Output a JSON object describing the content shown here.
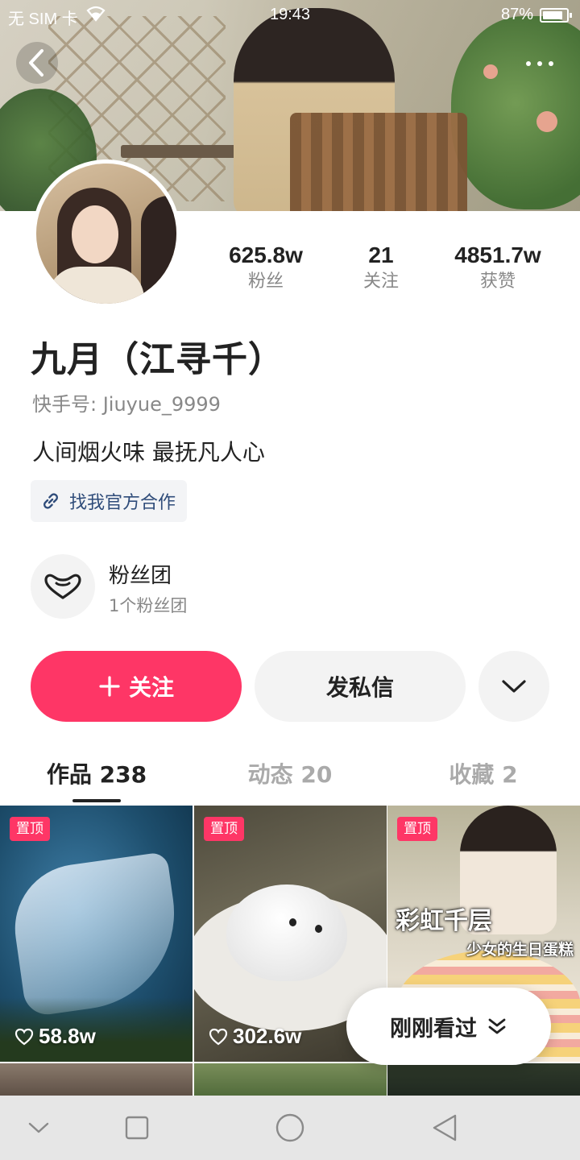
{
  "status_bar": {
    "carrier": "无 SIM 卡",
    "time": "19:43",
    "battery_text": "87%",
    "battery_level": 0.87
  },
  "header": {
    "back_icon": "chevron-left-icon",
    "more_icon": "ellipsis-icon"
  },
  "profile": {
    "stats": [
      {
        "value": "625.8w",
        "label": "粉丝"
      },
      {
        "value": "21",
        "label": "关注"
      },
      {
        "value": "4851.7w",
        "label": "获赞"
      }
    ],
    "name": "九月（江寻千）",
    "account_id": "快手号: Jiuyue_9999",
    "bio": "人间烟火味 最抚凡人心",
    "biz_link": "找我官方合作"
  },
  "fan_club": {
    "title": "粉丝团",
    "subtitle": "1个粉丝团"
  },
  "actions": {
    "follow": "关注",
    "message": "发私信"
  },
  "tabs": [
    {
      "label": "作品 238",
      "active": true
    },
    {
      "label": "动态 20",
      "active": false
    },
    {
      "label": "收藏 2",
      "active": false
    }
  ],
  "videos": [
    {
      "pinned_label": "置顶",
      "likes": "58.8w"
    },
    {
      "pinned_label": "置顶",
      "likes": "302.6w"
    },
    {
      "pinned_label": "置顶",
      "likes": "",
      "caption_main": "彩虹千层",
      "caption_sub": "少女的生日蛋糕"
    }
  ],
  "recent_pill": {
    "label": "刚刚看过"
  },
  "colors": {
    "accent": "#fe3666",
    "link": "#2f4c7a"
  }
}
